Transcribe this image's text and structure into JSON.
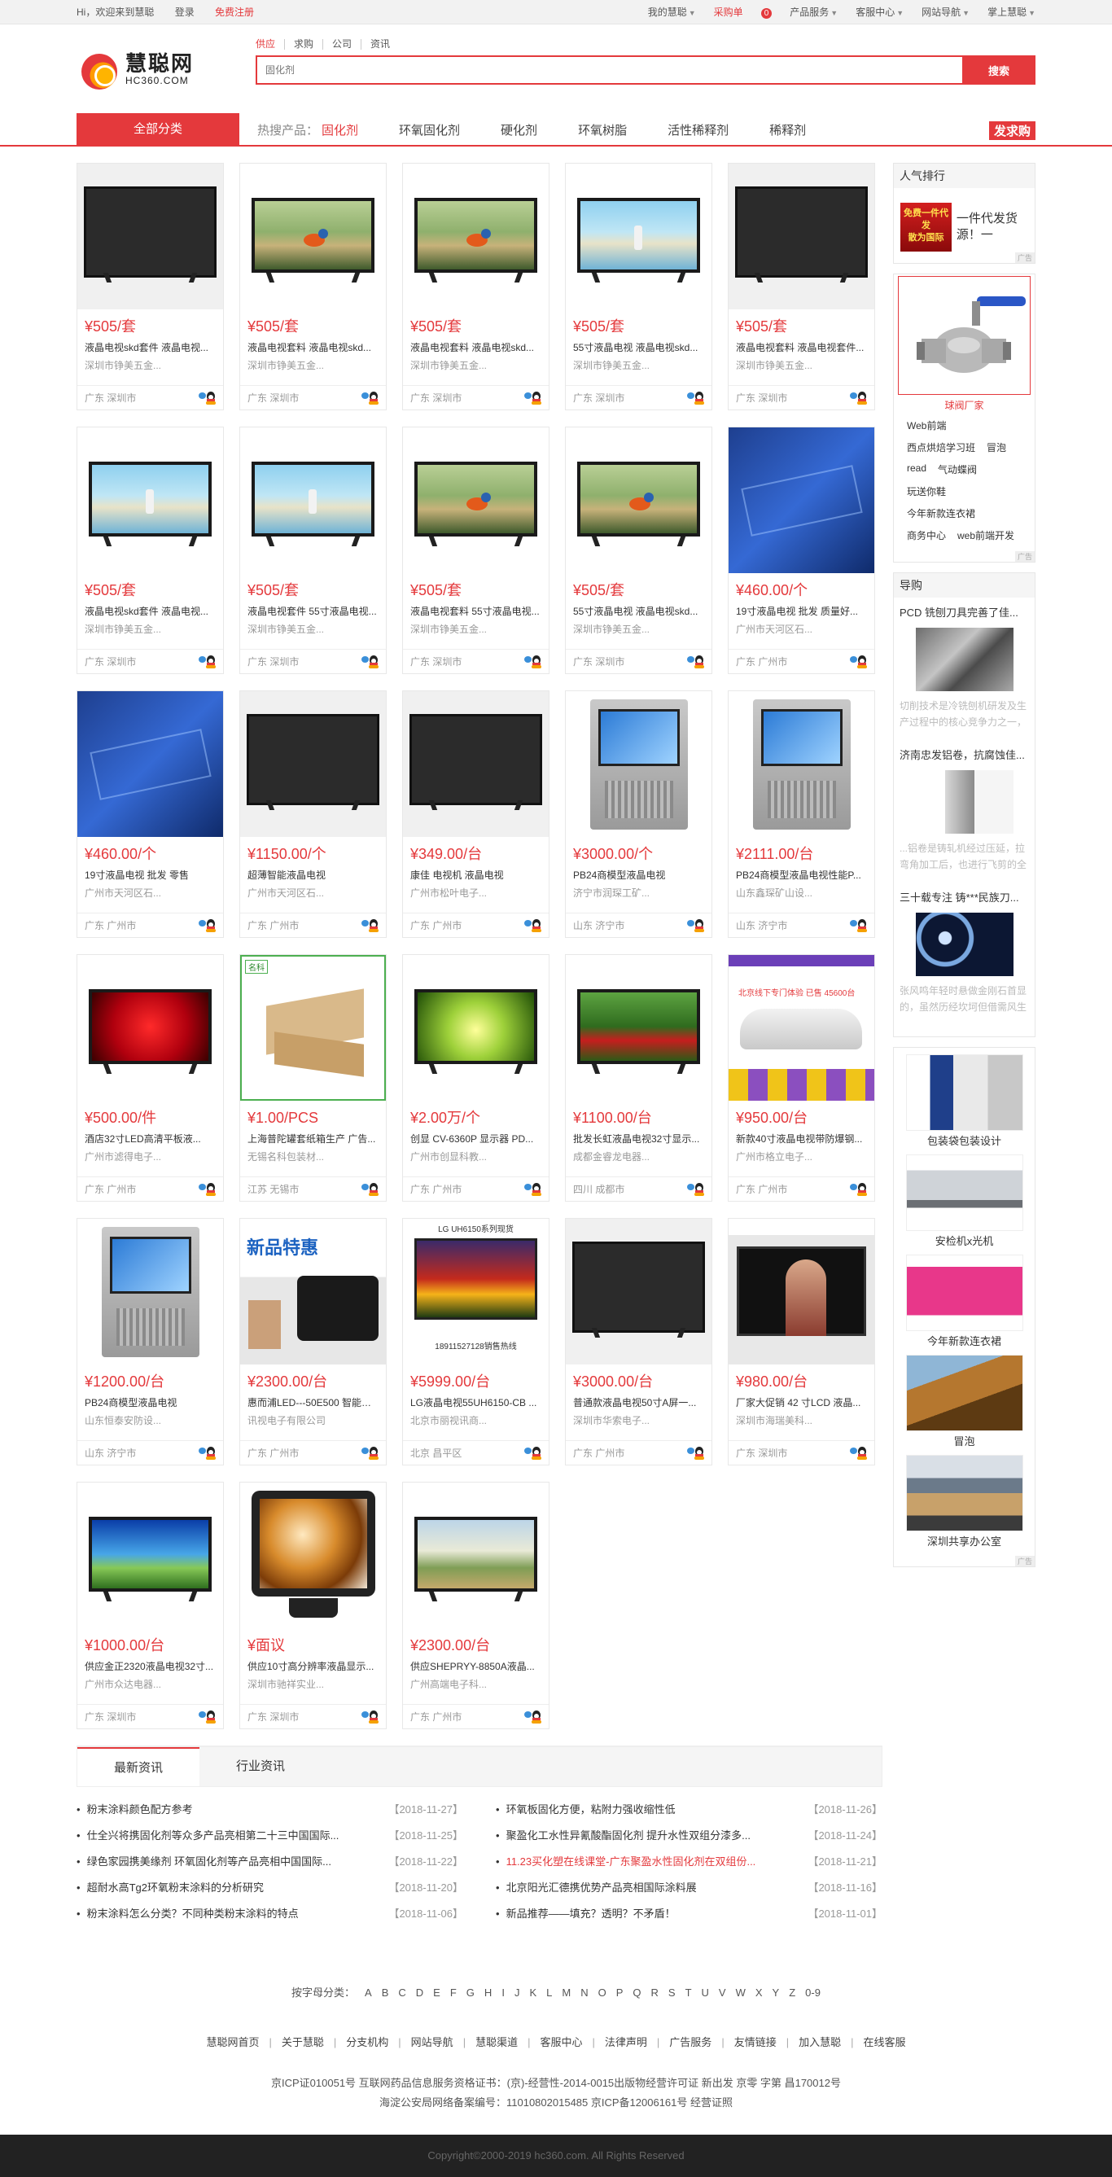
{
  "topbar": {
    "welcome": "Hi，欢迎来到慧聪",
    "login": "登录",
    "register": "免费注册",
    "right": [
      {
        "label": "我的慧聪",
        "caret": true
      },
      {
        "label": "采购单",
        "badge": "0"
      },
      {
        "label": "产品服务",
        "caret": true
      },
      {
        "label": "客服中心",
        "caret": true
      },
      {
        "label": "网站导航",
        "caret": true
      },
      {
        "label": "掌上慧聪",
        "caret": true
      }
    ]
  },
  "logo": {
    "cn": "慧聪网",
    "en": "HC360.COM"
  },
  "search": {
    "tabs": [
      "供应",
      "求购",
      "公司",
      "资讯"
    ],
    "placeholder": "固化剂",
    "button": "搜索"
  },
  "nav": {
    "all": "全部分类",
    "hot_label": "热搜产品：",
    "hot_first": "固化剂",
    "items": [
      "环氧固化剂",
      "硬化剂",
      "环氧树脂",
      "活性稀释剂",
      "稀释剂"
    ],
    "fa": "发求购"
  },
  "products": [
    {
      "price": "¥505/套",
      "title": "液晶电视skd套件 液晶电视...",
      "company": "深圳市铮美五金...",
      "loc": "广东 深圳市",
      "scene": "scene-dark"
    },
    {
      "price": "¥505/套",
      "title": "液晶电视套料 液晶电视skd...",
      "company": "深圳市铮美五金...",
      "loc": "广东 深圳市",
      "scene": "scene-bird"
    },
    {
      "price": "¥505/套",
      "title": "液晶电视套料 液晶电视skd...",
      "company": "深圳市铮美五金...",
      "loc": "广东 深圳市",
      "scene": "scene-bird"
    },
    {
      "price": "¥505/套",
      "title": "55寸液晶电视 液晶电视skd...",
      "company": "深圳市铮美五金...",
      "loc": "广东 深圳市",
      "scene": "scene-beach"
    },
    {
      "price": "¥505/套",
      "title": "液晶电视套料 液晶电视套件...",
      "company": "深圳市铮美五金...",
      "loc": "广东 深圳市",
      "scene": "scene-dark"
    },
    {
      "price": "¥505/套",
      "title": "液晶电视skd套件 液晶电视...",
      "company": "深圳市铮美五金...",
      "loc": "广东 深圳市",
      "scene": "scene-beach"
    },
    {
      "price": "¥505/套",
      "title": "液晶电视套件 55寸液晶电视...",
      "company": "深圳市铮美五金...",
      "loc": "广东 深圳市",
      "scene": "scene-beach"
    },
    {
      "price": "¥505/套",
      "title": "液晶电视套料 55寸液晶电视...",
      "company": "深圳市铮美五金...",
      "loc": "广东 深圳市",
      "scene": "scene-bird"
    },
    {
      "price": "¥505/套",
      "title": "55寸液晶电视 液晶电视skd...",
      "company": "深圳市铮美五金...",
      "loc": "广东 深圳市",
      "scene": "scene-bird"
    },
    {
      "price": "¥460.00/个",
      "title": "19寸液晶电视 批发 质量好...",
      "company": "广州市天河区石...",
      "loc": "广东 广州市",
      "scene": "scene-blue"
    },
    {
      "price": "¥460.00/个",
      "title": "19寸液晶电视 批发 零售",
      "company": "广州市天河区石...",
      "loc": "广东 广州市",
      "scene": "scene-blue"
    },
    {
      "price": "¥1150.00/个",
      "title": "超薄智能液晶电视",
      "company": "广州市天河区石...",
      "loc": "广东 广州市",
      "scene": "scene-dark"
    },
    {
      "price": "¥349.00/台",
      "title": "康佳 电视机 液晶电视",
      "company": "广州市松叶电子...",
      "loc": "广东 广州市",
      "scene": "scene-dark"
    },
    {
      "price": "¥3000.00/个",
      "title": "PB24商模型液晶电视",
      "company": "济宁市润琛工矿...",
      "loc": "山东 济宁市",
      "scene": "scene-kiosk"
    },
    {
      "price": "¥2111.00/台",
      "title": "PB24商模型液晶电视性能P...",
      "company": "山东鑫琛矿山设...",
      "loc": "山东 济宁市",
      "scene": "scene-kiosk"
    },
    {
      "price": "¥500.00/件",
      "title": "酒店32寸LED高清平板液...",
      "company": "广州市滤得电子...",
      "loc": "广东 广州市",
      "scene": "scene-red"
    },
    {
      "price": "¥1.00/PCS",
      "title": "上海普陀罐套纸箱生产 广告...",
      "company": "无锡名科包装材...",
      "loc": "江苏 无锡市",
      "scene": "scene-box"
    },
    {
      "price": "¥2.00万/个",
      "title": "创显 CV-6360P 显示器 PD...",
      "company": "广州市创显科教...",
      "loc": "广东 广州市",
      "scene": "scene-green"
    },
    {
      "price": "¥1100.00/台",
      "title": "批发长虹液晶电视32寸显示...",
      "company": "成都金睿龙电器...",
      "loc": "四川 成都市",
      "scene": "scene-cherry"
    },
    {
      "price": "¥950.00/台",
      "title": "新款40寸液晶电视带防爆钢...",
      "company": "广州市格立电子...",
      "loc": "广东 广州市",
      "scene": "scene-car"
    },
    {
      "price": "¥1200.00/台",
      "title": "PB24商模型液晶电视",
      "company": "山东恒泰安防设...",
      "loc": "山东 济宁市",
      "scene": "scene-kiosk"
    },
    {
      "price": "¥2300.00/台",
      "title": "惠而浦LED---50E500 智能网...",
      "company": "讯视电子有限公司",
      "loc": "广东 广州市",
      "scene": "scene-newprod"
    },
    {
      "price": "¥5999.00/台",
      "title": "LG液晶电视55UH6150-CB ...",
      "company": "北京市丽视讯商...",
      "loc": "北京 昌平区",
      "scene": "scene-tulip"
    },
    {
      "price": "¥3000.00/台",
      "title": "普通款液晶电视50寸A屏一...",
      "company": "深圳市华索电子...",
      "loc": "广东 广州市",
      "scene": "scene-dark"
    },
    {
      "price": "¥980.00/台",
      "title": "厂家大促销 42 寸LCD 液晶...",
      "company": "深圳市海瑞美科...",
      "loc": "广东 深圳市",
      "scene": "scene-woman"
    },
    {
      "price": "¥1000.00/台",
      "title": "供应金正2320液晶电视32寸...",
      "company": "广州市众达电器...",
      "loc": "广东 深圳市",
      "scene": "scene-sky"
    },
    {
      "price": "¥面议",
      "title": "供应10寸高分辨率液晶显示...",
      "company": "深圳市驰祥实业...",
      "loc": "广东 深圳市",
      "scene": "scene-swirl"
    },
    {
      "price": "¥2300.00/台",
      "title": "供应SHEPRYY-8850A液晶...",
      "company": "广州高端电子科...",
      "loc": "广东 广州市",
      "scene": "scene-field"
    }
  ],
  "image_texts": {
    "box_badge": "名科",
    "lg_title": "LG UH6150系列现货",
    "lg_phone": "18911527128销售热线",
    "newprod": "新品特惠",
    "car_banner": "北京线下专门体验 已售 45600台"
  },
  "sidebar": {
    "rank_title": "人气排行",
    "rank_ad_pic": "免费一件代发",
    "rank_ad_pic2": "散为国际",
    "rank_ad_text": "一件代发货源！一",
    "ad_tag": "广告",
    "valve_caption": "球阀厂家",
    "tags": [
      "Web前端",
      "西点烘焙学习班",
      "冒泡",
      "read",
      "气动蝶阀",
      "玩送你鞋",
      "今年新款连衣裙",
      "商务中心",
      "web前端开发"
    ],
    "guide_title": "导购",
    "guides": [
      {
        "title": "PCD 铣刨刀具完善了佳...",
        "desc": "切削技术是冷铣刨机研发及生产过程中的核心竞争力之一，铣刨",
        "pic": "guide1"
      },
      {
        "title": "济南忠发铝卷，抗腐蚀佳...",
        "desc": "...铝卷是铸轧机经过压延，拉弯角加工后，也进行飞剪的全属",
        "pic": "guide2"
      },
      {
        "title": "三十载专注 铸***民族刀...",
        "desc": "张风鸣年轻时悬做金刚石首显的，虽然历经坎坷但借需风生水",
        "pic": "guide3"
      }
    ],
    "products": [
      {
        "name": "包装袋包装设计",
        "pic": "pack"
      },
      {
        "name": "安检机x光机",
        "pic": "xray"
      },
      {
        "name": "今年新款连衣裙",
        "pic": "dress"
      },
      {
        "name": "冒泡",
        "pic": "wood"
      },
      {
        "name": "深圳共享办公室",
        "pic": "office"
      }
    ]
  },
  "news": {
    "tabs": [
      "最新资讯",
      "行业资讯"
    ],
    "left": [
      {
        "title": "粉末涂料颜色配方参考",
        "date": "【2018-11-27】"
      },
      {
        "title": "仕全兴将携固化剂等众多产品亮相第二十三中国国际...",
        "date": "【2018-11-25】"
      },
      {
        "title": "绿色家园携美缘剂 环氧固化剂等产品亮相中国国际...",
        "date": "【2018-11-22】"
      },
      {
        "title": "超耐水高Tg2环氧粉末涂料的分析研究",
        "date": "【2018-11-20】"
      },
      {
        "title": "粉末涂料怎么分类？不同种类粉末涂料的特点",
        "date": "【2018-11-06】"
      }
    ],
    "right": [
      {
        "title": "环氧板固化方便，粘附力强收缩性低",
        "date": "【2018-11-26】",
        "red": false
      },
      {
        "title": "聚盈化工水性异氰酸酯固化剂 提升水性双组分漆多...",
        "date": "【2018-11-24】",
        "red": false
      },
      {
        "title": "11.23买化塑在线课堂-广东聚盈水性固化剂在双组份...",
        "date": "【2018-11-21】",
        "red": true
      },
      {
        "title": "北京阳光汇德携优势产品亮相国际涂料展",
        "date": "【2018-11-16】",
        "red": false
      },
      {
        "title": "新品推荐——填充？透明？不矛盾！",
        "date": "【2018-11-01】",
        "red": false
      }
    ]
  },
  "footer": {
    "letters_label": "按字母分类：",
    "letters": [
      "A",
      "B",
      "C",
      "D",
      "E",
      "F",
      "G",
      "H",
      "I",
      "J",
      "K",
      "L",
      "M",
      "N",
      "O",
      "P",
      "Q",
      "R",
      "S",
      "T",
      "U",
      "V",
      "W",
      "X",
      "Y",
      "Z",
      "0-9"
    ],
    "links": [
      "慧聪网首页",
      "关于慧聪",
      "分支机构",
      "网站导航",
      "慧聪渠道",
      "客服中心",
      "法律声明",
      "广告服务",
      "友情链接",
      "加入慧聪",
      "在线客服"
    ],
    "icp1": "京ICP证010051号 互联网药品信息服务资格证书：(京)-经营性-2014-0015出版物经营许可证 新出发 京零 字第 昌170012号",
    "icp2": "海淀公安局网络备案编号：1101080201548​5    京ICP备12006161号 经营证照",
    "copyright": "Copyright©2000-2019 hc360.com. All Rights Reserved"
  }
}
